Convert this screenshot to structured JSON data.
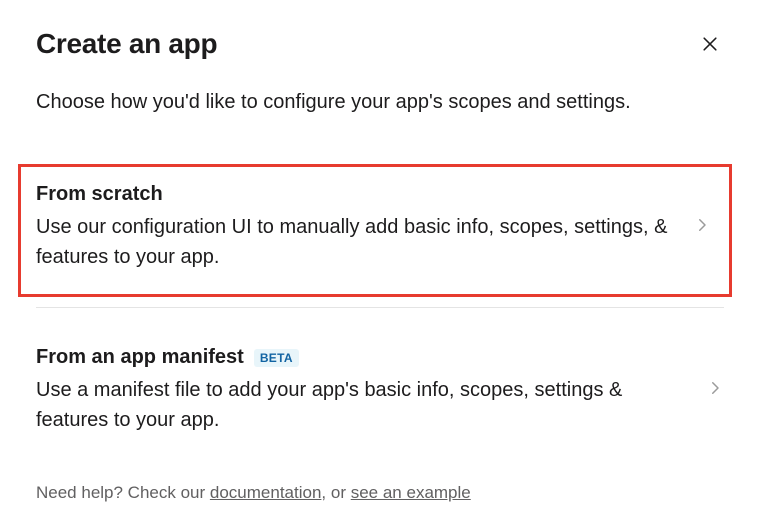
{
  "header": {
    "title": "Create an app"
  },
  "subtitle": "Choose how you'd like to configure your app's scopes and settings.",
  "options": [
    {
      "title": "From scratch",
      "description": "Use our configuration UI to manually add basic info, scopes, settings, & features to your app."
    },
    {
      "title": "From an app manifest",
      "badge": "BETA",
      "description": "Use a manifest file to add your app's basic info, scopes, settings & features to your app."
    }
  ],
  "help": {
    "prefix": "Need help? Check our ",
    "link1": "documentation",
    "middle": ", or ",
    "link2": "see an example"
  }
}
